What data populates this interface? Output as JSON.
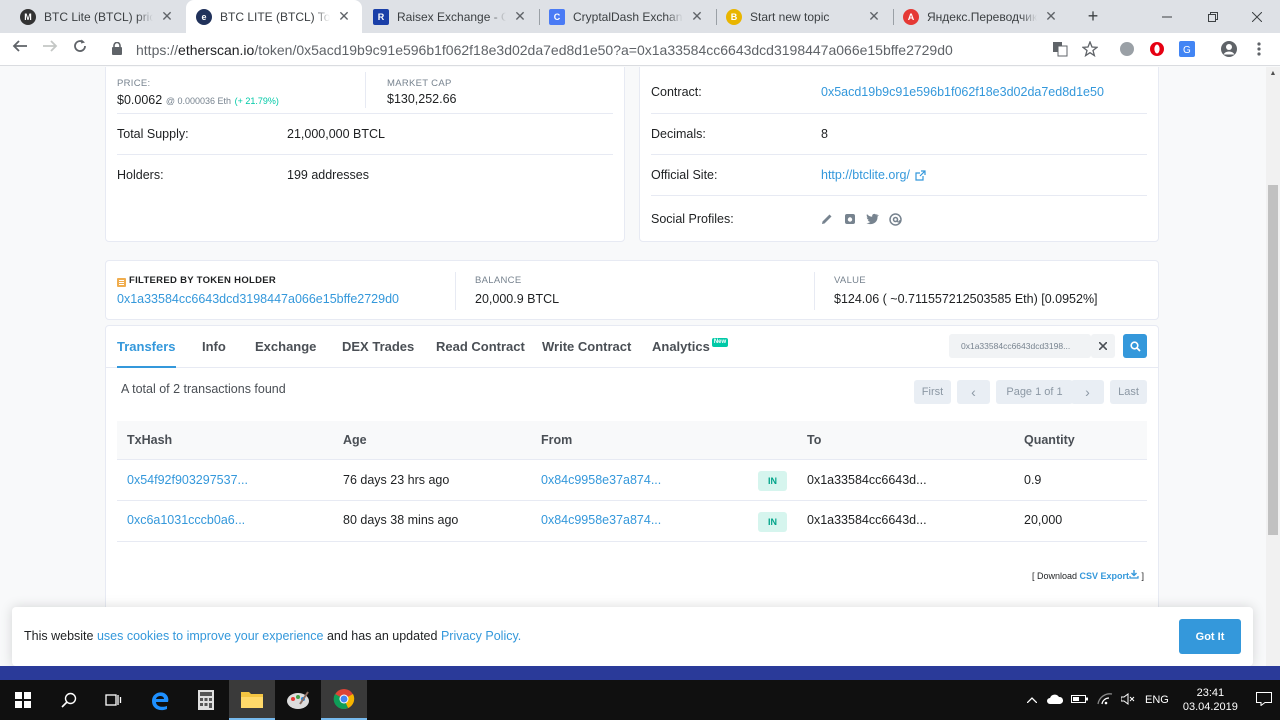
{
  "browser": {
    "tabs": [
      {
        "title": "BTC Lite (BTCL) price, ch",
        "favicon_color": "#333333",
        "favicon_text": "M"
      },
      {
        "title": "BTC LITE (BTCL) Token T",
        "favicon_color": "#21325b",
        "favicon_text": "e"
      },
      {
        "title": "Raisex Exchange - Crypt",
        "favicon_color": "#1a3fa8",
        "favicon_text": "R"
      },
      {
        "title": "CryptalDash Exchange",
        "favicon_color": "#4a7bf5",
        "favicon_text": "C"
      },
      {
        "title": "Start new topic",
        "favicon_color": "#e9b500",
        "favicon_text": "B"
      },
      {
        "title": "Яндекс.Переводчик – с",
        "favicon_color": "#e53935",
        "favicon_text": "A"
      }
    ],
    "close_symbol": "✕",
    "new_tab_symbol": "+",
    "url_host": "etherscan.io",
    "url_scheme": "https://",
    "url_path": "/token/0x5acd19b9c91e596b1f062f18e3d02da7ed8d1e50?a=0x1a33584cc6643dcd3198447a066e15bffe2729d0"
  },
  "overview": {
    "price_label": "PRICE:",
    "price_value": "$0.0062",
    "price_eth": "@ 0.000036 Eth",
    "price_change": "(+ 21.79%)",
    "marketcap_label": "MARKET CAP",
    "marketcap_value": "$130,252.66",
    "total_supply_label": "Total Supply:",
    "total_supply_value": "21,000,000 BTCL",
    "holders_label": "Holders:",
    "holders_value": "199 addresses"
  },
  "profile": {
    "contract_label": "Contract:",
    "contract_value": "0x5acd19b9c91e596b1f062f18e3d02da7ed8d1e50",
    "decimals_label": "Decimals:",
    "decimals_value": "8",
    "site_label": "Official Site:",
    "site_value": "http://btclite.org/",
    "social_label": "Social Profiles:",
    "social_icons": [
      "pencil-icon",
      "instagram-icon",
      "twitter-icon",
      "at-icon"
    ]
  },
  "filter": {
    "title": "FILTERED BY TOKEN HOLDER",
    "address": "0x1a33584cc6643dcd3198447a066e15bffe2729d0",
    "balance_label": "BALANCE",
    "balance_value": "20,000.9 BTCL",
    "value_label": "VALUE",
    "value_value": "$124.06 ( ~0.711557212503585 Eth) [0.0952%]"
  },
  "tabs": [
    {
      "label": "Transfers",
      "active": true
    },
    {
      "label": "Info"
    },
    {
      "label": "Exchange"
    },
    {
      "label": "DEX Trades"
    },
    {
      "label": "Read Contract"
    },
    {
      "label": "Write Contract"
    },
    {
      "label": "Analytics"
    }
  ],
  "new_badge": "New",
  "search": {
    "value": "0x1a33584cc6643dcd3198..."
  },
  "summary": "A total of 2 transactions found",
  "pager": {
    "first": "First",
    "prev": "‹",
    "page": "Page 1 of 1",
    "next": "›",
    "last": "Last"
  },
  "table": {
    "headers": [
      "TxHash",
      "Age",
      "From",
      "To",
      "Quantity"
    ],
    "direction_label": "IN",
    "rows": [
      {
        "hash": "0x54f92f903297537...",
        "age": "76 days 23 hrs ago",
        "from": "0x84c9958e37a874...",
        "to": "0x1a33584cc6643d...",
        "qty": "0.9"
      },
      {
        "hash": "0xc6a1031cccb0a6...",
        "age": "80 days 38 mins ago",
        "from": "0x84c9958e37a874...",
        "to": "0x1a33584cc6643d...",
        "qty": "20,000"
      }
    ]
  },
  "download": {
    "prefix": "[ Download ",
    "link": "CSV Export",
    "suffix": " ]"
  },
  "cookie": {
    "text1": "This website ",
    "link1": "uses cookies to improve your experience",
    "text2": " and has an updated ",
    "link2": "Privacy Policy.",
    "button": "Got It"
  },
  "taskbar": {
    "lang": "ENG",
    "time": "23:41",
    "date": "03.04.2019"
  },
  "colors": {
    "accent": "#3498db",
    "success": "#00c9a7"
  }
}
